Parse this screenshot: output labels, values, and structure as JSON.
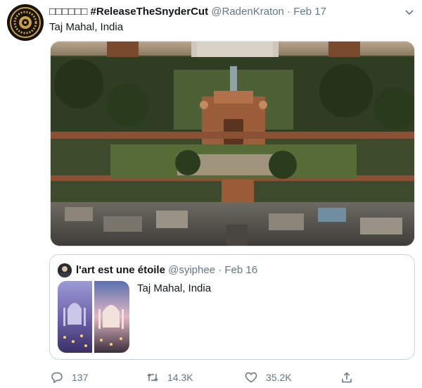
{
  "tweet": {
    "display_name": "□□□□□□ #ReleaseTheSnyderCut",
    "handle": "@RadenKraton",
    "separator": "·",
    "date": "Feb 17",
    "text": "Taj Mahal, India",
    "avatar_icon": "ornate-emblem-avatar"
  },
  "quoted": {
    "display_name": "l'art est une étoile",
    "handle": "@syiphee",
    "separator": "·",
    "date": "Feb 16",
    "text": "Taj Mahal, India"
  },
  "actions": {
    "reply_count": "137",
    "retweet_count": "14.3K",
    "like_count": "35.2K"
  },
  "colors": {
    "text_primary": "#14171a",
    "text_secondary": "#657786",
    "border": "#ccd6dd"
  }
}
